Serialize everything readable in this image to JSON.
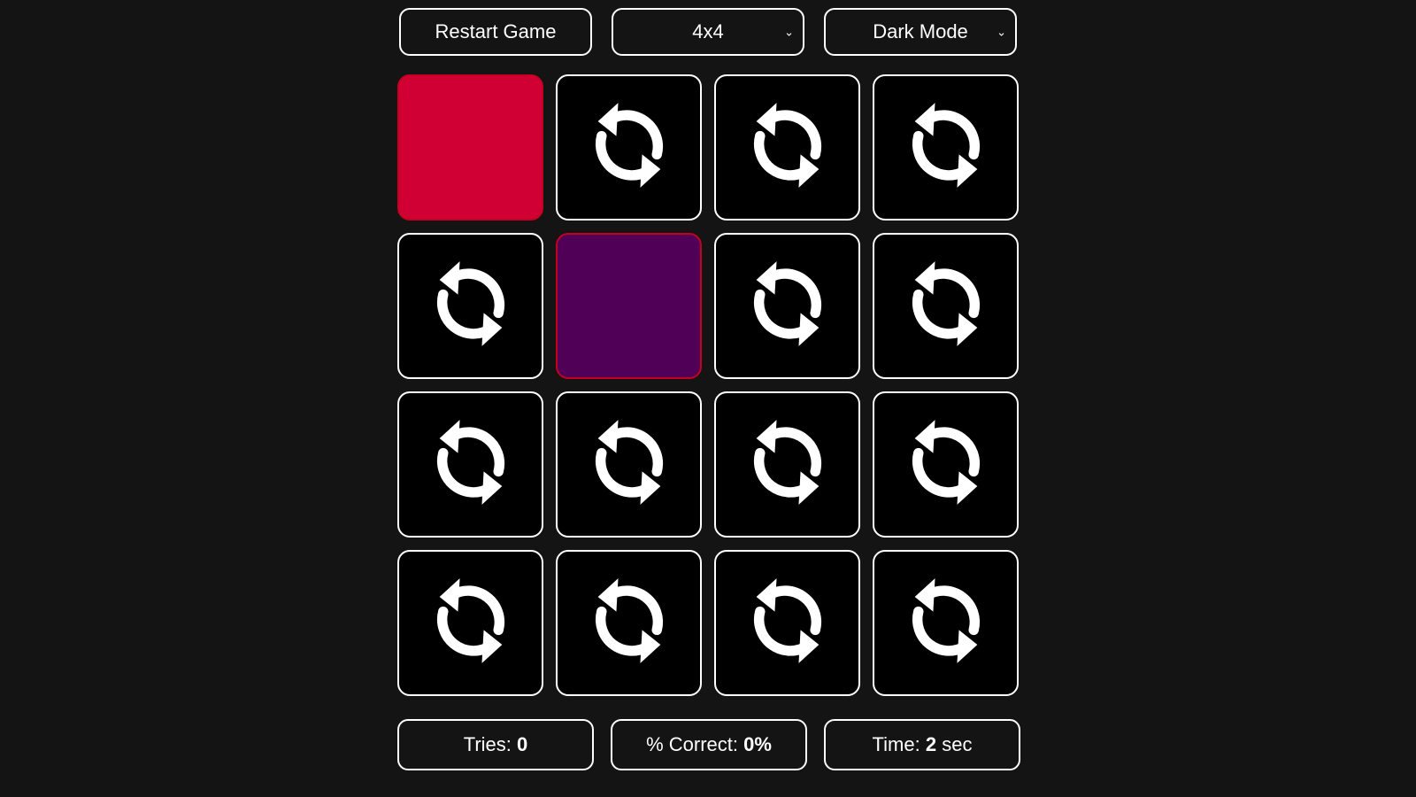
{
  "controls": {
    "restart_label": "Restart Game",
    "size_select_value": "4x4",
    "theme_select_value": "Dark Mode"
  },
  "board": {
    "cards": [
      {
        "state": "revealed",
        "color": "#d10034"
      },
      {
        "state": "hidden",
        "icon": "swap-arrows-icon"
      },
      {
        "state": "hidden",
        "icon": "swap-arrows-icon"
      },
      {
        "state": "hidden",
        "icon": "swap-arrows-icon"
      },
      {
        "state": "hidden",
        "icon": "swap-arrows-icon"
      },
      {
        "state": "revealed",
        "color": "#510057"
      },
      {
        "state": "hidden",
        "icon": "swap-arrows-icon"
      },
      {
        "state": "hidden",
        "icon": "swap-arrows-icon"
      },
      {
        "state": "hidden",
        "icon": "swap-arrows-icon"
      },
      {
        "state": "hidden",
        "icon": "swap-arrows-icon"
      },
      {
        "state": "hidden",
        "icon": "swap-arrows-icon"
      },
      {
        "state": "hidden",
        "icon": "swap-arrows-icon"
      },
      {
        "state": "hidden",
        "icon": "swap-arrows-icon"
      },
      {
        "state": "hidden",
        "icon": "swap-arrows-icon"
      },
      {
        "state": "hidden",
        "icon": "swap-arrows-icon"
      },
      {
        "state": "hidden",
        "icon": "swap-arrows-icon"
      }
    ]
  },
  "stats": {
    "tries_label": "Tries: ",
    "tries_value": "0",
    "correct_label": "% Correct: ",
    "correct_value": "0%",
    "time_label": "Time: ",
    "time_value": "2",
    "time_unit": " sec"
  },
  "colors": {
    "background": "#141414",
    "card_back": "#000000",
    "card_border": "#ffffff",
    "revealed_border": "#c4001f"
  }
}
